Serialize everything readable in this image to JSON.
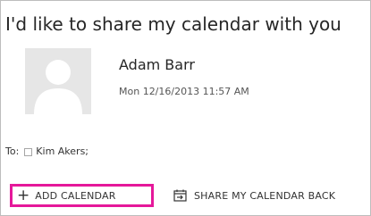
{
  "message": {
    "subject": "I'd like to share my calendar with you",
    "sender": {
      "name": "Adam Barr",
      "timestamp": "Mon 12/16/2013 11:57 AM",
      "avatar_icon": "person-silhouette-icon"
    },
    "to": {
      "label": "To:",
      "recipients": [
        "Kim Akers;"
      ]
    }
  },
  "actions": {
    "add_calendar": {
      "label": "ADD CALENDAR",
      "icon": "plus-icon",
      "highlight_color": "#e5189a"
    },
    "share_back": {
      "label": "SHARE MY CALENDAR BACK",
      "icon": "share-calendar-icon"
    }
  }
}
